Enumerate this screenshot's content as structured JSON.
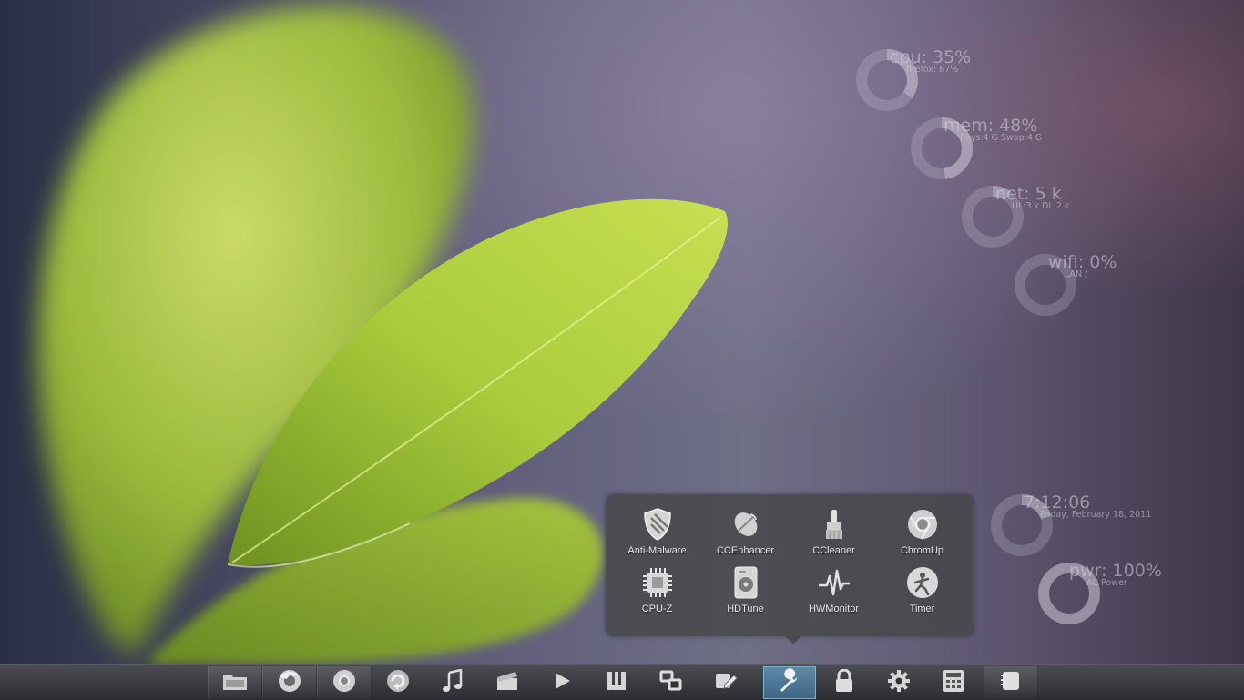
{
  "monitors": {
    "cpu": {
      "title": "cpu: 35%",
      "sub": "firefox: 67%",
      "value": 0.35
    },
    "mem": {
      "title": "mem: 48%",
      "sub": "Phys:4 G Swap:4 G",
      "value": 0.48
    },
    "net": {
      "title": "net: 5 k",
      "sub": "UL:3 k  DL:2 k",
      "value": 0.1
    },
    "wifi": {
      "title": "wifi: 0%",
      "sub": "LAN /",
      "value": 0.0
    },
    "clock": {
      "title": "7:12:06",
      "sub": "Friday, February 18, 2011",
      "value": 0.2
    },
    "power": {
      "title": "pwr: 100%",
      "sub": "AC Power",
      "value": 1.0
    }
  },
  "popup": {
    "items": [
      {
        "label": "Anti-Malware",
        "icon": "shield-icon"
      },
      {
        "label": "CCEnhancer",
        "icon": "satellite-dish-icon"
      },
      {
        "label": "CCleaner",
        "icon": "brush-icon"
      },
      {
        "label": "ChromUp",
        "icon": "chrome-icon"
      },
      {
        "label": "CPU-Z",
        "icon": "chip-icon"
      },
      {
        "label": "HDTune",
        "icon": "hard-drive-icon"
      },
      {
        "label": "HWMonitor",
        "icon": "pulse-icon"
      },
      {
        "label": "Timer",
        "icon": "stopwatch-icon"
      }
    ]
  },
  "dock": {
    "items": [
      {
        "icon": "folder-icon"
      },
      {
        "icon": "firefox-icon"
      },
      {
        "icon": "chrome-icon"
      },
      {
        "icon": "update-icon"
      },
      {
        "icon": "music-icon"
      },
      {
        "icon": "clapperboard-icon"
      },
      {
        "icon": "play-icon"
      },
      {
        "icon": "utorrent-icon"
      },
      {
        "icon": "windows-icon"
      },
      {
        "icon": "edit-icon"
      },
      {
        "icon": "wrench-icon",
        "active": true
      },
      {
        "icon": "lock-icon"
      },
      {
        "icon": "gear-icon"
      },
      {
        "icon": "calculator-icon"
      },
      {
        "icon": "notes-icon"
      }
    ]
  },
  "colors": {
    "active_dock": "#4f7ea0",
    "leaf_green": "#9fc43a",
    "text": "#e8e8e8"
  }
}
